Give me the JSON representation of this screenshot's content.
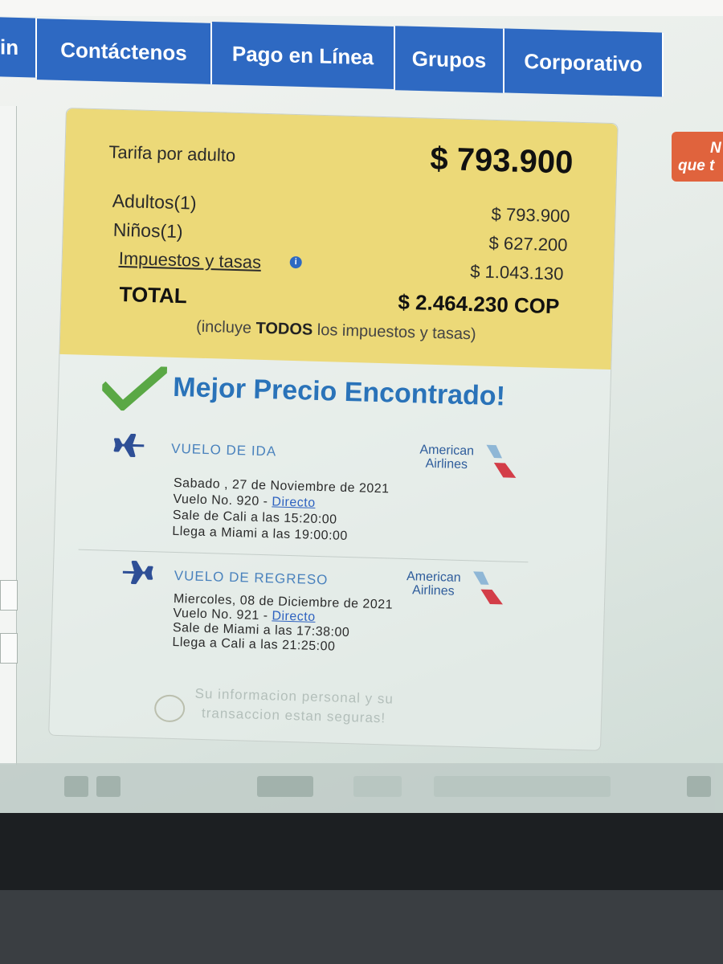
{
  "nav": {
    "tabs": [
      {
        "label": "in"
      },
      {
        "label": "Contáctenos"
      },
      {
        "label": "Pago en Línea"
      },
      {
        "label": "Grupos"
      },
      {
        "label": "Corporativo"
      }
    ]
  },
  "side_badge": {
    "line1": "N",
    "line2": "que t"
  },
  "price": {
    "fare_label": "Tarifa por adulto",
    "fare_value": "$ 793.900",
    "adults_label": "Adultos(1)",
    "adults_value": "$ 793.900",
    "children_label": "Niños(1)",
    "children_value": "$ 627.200",
    "taxes_label": "Impuestos y tasas",
    "taxes_value": "$ 1.043.130",
    "total_label": "TOTAL",
    "total_value": "$ 2.464.230 COP",
    "includes_pre": "(incluye ",
    "includes_bold": "TODOS",
    "includes_post": " los impuestos y tasas)"
  },
  "best_price": "Mejor Precio Encontrado!",
  "outbound": {
    "title": "VUELO DE IDA",
    "airline_line1": "American",
    "airline_line2": "Airlines",
    "date": "Sabado , 27 de Noviembre de 2021",
    "flight_prefix": "Vuelo No. 920 - ",
    "flight_link": "Directo",
    "departs": "Sale de Cali a las 15:20:00",
    "arrives": "Llega a Miami a las 19:00:00"
  },
  "return": {
    "title": "VUELO DE REGRESO",
    "airline_line1": "American",
    "airline_line2": "Airlines",
    "date": "Miercoles, 08 de Diciembre de 2021",
    "flight_prefix": "Vuelo No. 921 - ",
    "flight_link": "Directo",
    "departs": "Sale de Miami a las 17:38:00",
    "arrives": "Llega a Cali a las 21:25:00"
  },
  "secure": {
    "line1": "Su informacion personal y su",
    "line2": "transaccion estan seguras!"
  },
  "colors": {
    "nav_blue": "#2e69c2",
    "price_box": "#ecd978",
    "headline_blue": "#2a73b9",
    "check_green": "#5aa845",
    "badge_orange": "#e0633d"
  }
}
